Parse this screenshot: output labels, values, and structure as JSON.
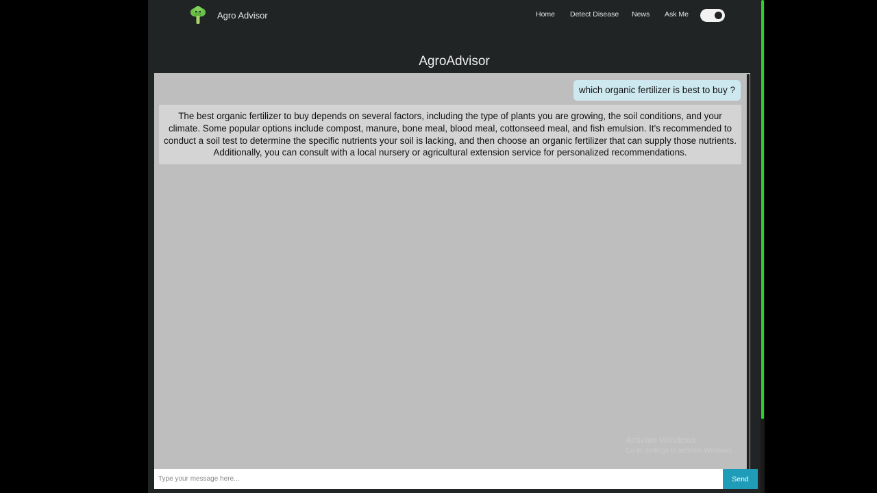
{
  "header": {
    "brand": "Agro Advisor",
    "logo_icon": "broccoli-icon",
    "nav": [
      "Home",
      "Detect Disease",
      "News",
      "Ask Me"
    ],
    "theme_toggle": "on"
  },
  "page_title": "AgroAdvisor",
  "messages": {
    "user": "which organic fertilizer is best to buy ?",
    "bot": "The best organic fertilizer to buy depends on several factors, including the type of plants you are growing, the soil conditions, and your climate. Some popular options include compost, manure, bone meal, blood meal, cottonseed meal, and fish emulsion. It's recommended to conduct a soil test to determine the specific nutrients your soil is lacking, and then choose an organic fertilizer that can supply those nutrients. Additionally, you can consult with a local nursery or agricultural extension service for personalized recommendations."
  },
  "watermark": {
    "title": "Activate Windows",
    "subtitle": "Go to Settings to activate Windows."
  },
  "composer": {
    "placeholder": "Type your message here...",
    "send_label": "Send"
  },
  "colors": {
    "accent": "#1f9cb8",
    "scroll_accent": "#2bd12b",
    "background": "#212424",
    "chat_background": "#bebebe"
  }
}
